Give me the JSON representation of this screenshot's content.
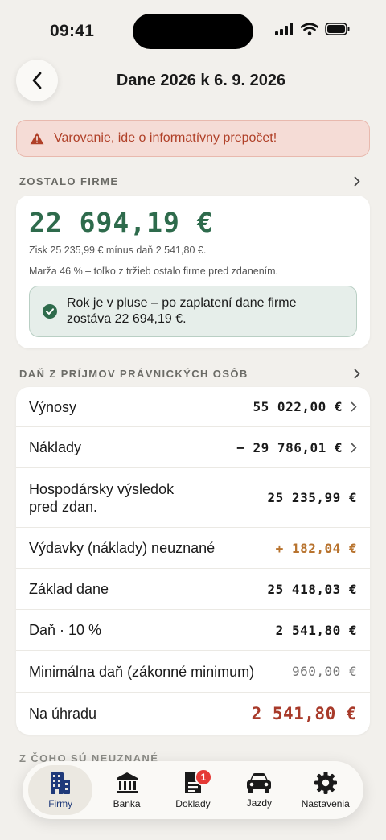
{
  "status_bar": {
    "time": "09:41"
  },
  "header": {
    "title": "Dane 2026 k 6. 9. 2026"
  },
  "warning": {
    "text": "Varovanie, ide o informatívny prepočet!"
  },
  "remaining": {
    "section_label": "ZOSTALO FIRME",
    "amount": "22 694,19 €",
    "note1": "Zisk 25 235,99 € mínus daň 2 541,80 €.",
    "note2": "Marža 46 % – toľko z tržieb ostalo firme pred zdanením.",
    "ok_line1": "Rok je v pluse – po zaplatení dane firme",
    "ok_line2": "zostáva 22 694,19 €."
  },
  "tax": {
    "section_label": "DAŇ Z PRÍJMOV PRÁVNICKÝCH OSÔB",
    "rows": [
      {
        "label": "Výnosy",
        "value": "55 022,00 €",
        "color": "#1a1a1a"
      },
      {
        "label": "Náklady",
        "value": "− 29 786,01 €",
        "color": "#1a1a1a"
      },
      {
        "label_line1": "Hospodársky výsledok",
        "label_line2": "pred zdan.",
        "value": "25 235,99 €",
        "color": "#1a1a1a"
      },
      {
        "label": "Výdavky (náklady) neuznané",
        "value": "+ 182,04 €",
        "color": "#b8732e"
      },
      {
        "label": "Základ dane",
        "value": "25 418,03 €",
        "color": "#1a1a1a"
      },
      {
        "label": "Daň · 10 %",
        "value": "2 541,80 €",
        "color": "#1a1a1a"
      },
      {
        "label": "Minimálna daň (zákonné minimum)",
        "value": "960,00 €",
        "color": "#777777"
      },
      {
        "label": "Na úhradu",
        "value": "2 541,80 €",
        "color": "#a83a2a"
      }
    ]
  },
  "next_section": {
    "label": "Z ČOHO SÚ NEUZNANÉ"
  },
  "tabbar": {
    "tabs": [
      {
        "label": "Firmy",
        "icon": "building-icon",
        "active": true
      },
      {
        "label": "Banka",
        "icon": "bank-icon"
      },
      {
        "label": "Doklady",
        "icon": "document-icon",
        "badge": "1"
      },
      {
        "label": "Jazdy",
        "icon": "car-icon"
      },
      {
        "label": "Nastavenia",
        "icon": "gear-icon"
      }
    ]
  }
}
